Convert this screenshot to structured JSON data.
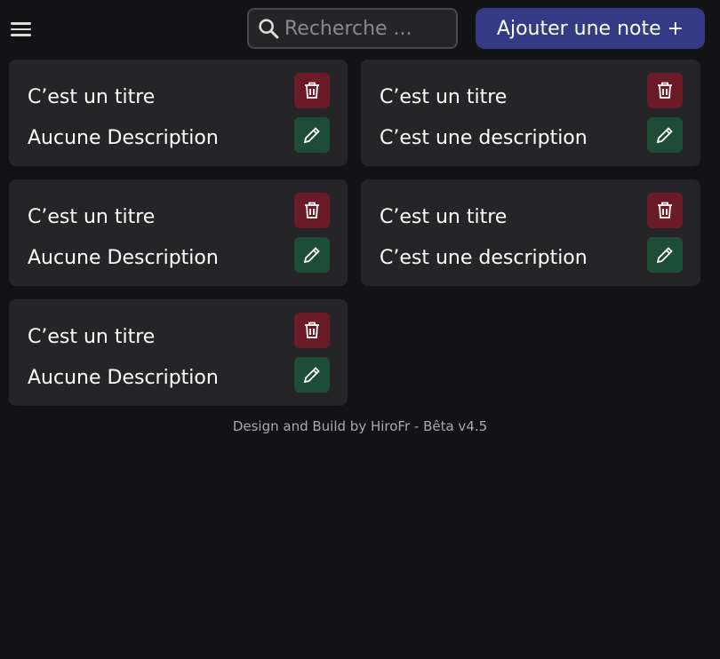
{
  "header": {
    "search_placeholder": "Recherche ...",
    "add_label": "Ajouter une note +"
  },
  "notes": [
    {
      "title": "C’est un titre",
      "description": "Aucune Description"
    },
    {
      "title": "C’est un titre",
      "description": "C’est une description"
    },
    {
      "title": "C’est un titre",
      "description": "Aucune Description"
    },
    {
      "title": "C’est un titre",
      "description": "C’est une description"
    },
    {
      "title": "C’est un titre",
      "description": "Aucune Description"
    }
  ],
  "footer": {
    "text": "Design and Build by HiroFr - Bêta v4.5"
  },
  "colors": {
    "background": "#131315",
    "card": "#252527",
    "primary": "#343b86",
    "delete": "#6b1b27",
    "edit": "#1d4d36"
  },
  "icons": {
    "menu": "hamburger-menu-icon",
    "search": "search-icon",
    "delete": "trash-icon",
    "edit": "pencil-icon"
  }
}
